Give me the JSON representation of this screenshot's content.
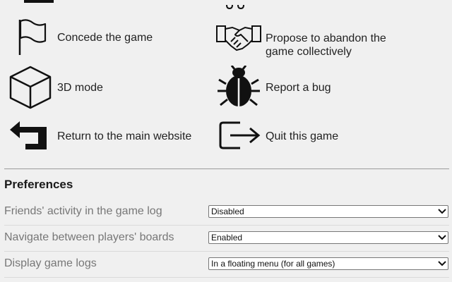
{
  "actions": {
    "concede": {
      "label": "Concede the game",
      "icon": "flag-icon"
    },
    "abandon": {
      "label_line1": "Propose to abandon the",
      "label_line2": "game collectively",
      "icon": "handshake-icon"
    },
    "mode3d": {
      "label": "3D mode",
      "icon": "cube-icon"
    },
    "bug": {
      "label": "Report a bug",
      "icon": "bug-icon"
    },
    "return_main": {
      "label": "Return to the main website",
      "icon": "return-arrow-icon"
    },
    "quit": {
      "label": "Quit this game",
      "icon": "exit-icon"
    }
  },
  "preferences": {
    "title": "Preferences",
    "rows": [
      {
        "label": "Friends' activity in the game log",
        "value": "Disabled"
      },
      {
        "label": "Navigate between players' boards",
        "value": "Enabled"
      },
      {
        "label": "Display game logs",
        "value": "In a floating menu (for all games)"
      }
    ]
  }
}
